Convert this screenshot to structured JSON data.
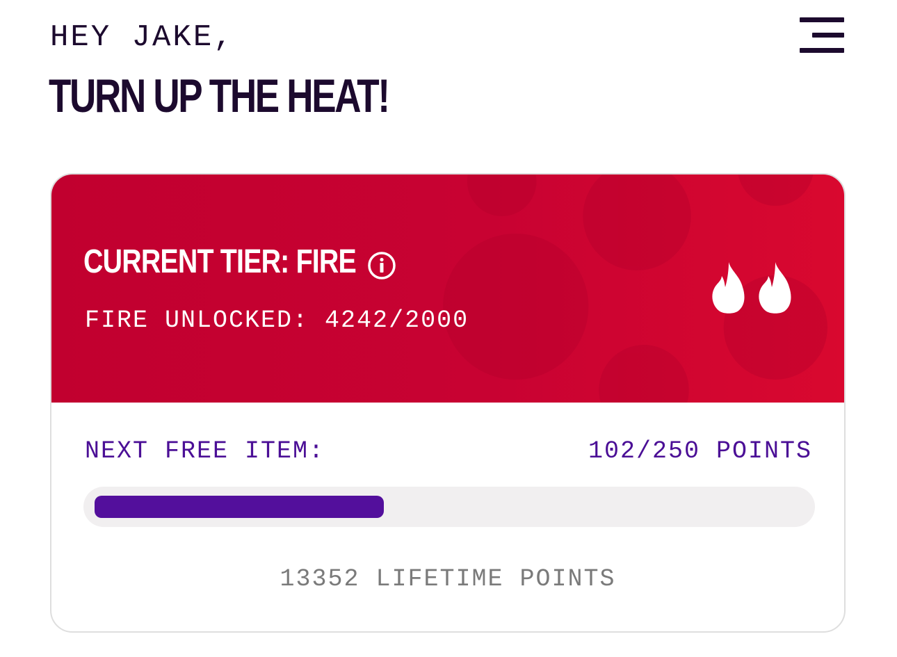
{
  "header": {
    "greeting": "HEY JAKE,",
    "headline": "TURN UP THE HEAT!",
    "menu_icon": "hamburger-menu-icon"
  },
  "tier_card": {
    "tier_title": "CURRENT TIER: FIRE",
    "info_icon": "info-icon",
    "tier_progress_text": "FIRE UNLOCKED: 4242/2000",
    "tier_icon": "double-flame-icon",
    "next_item_label": "NEXT FREE ITEM:",
    "next_item_points": "102/250 POINTS",
    "next_item_current": 102,
    "next_item_goal": 250,
    "lifetime_points": "13352 LIFETIME POINTS"
  },
  "colors": {
    "tier_panel": "#c8002f",
    "accent_purple": "#530f9c",
    "text_dark": "#1c0a2e",
    "progress_track": "#f1eff0",
    "muted_text": "#7a7a7a"
  }
}
